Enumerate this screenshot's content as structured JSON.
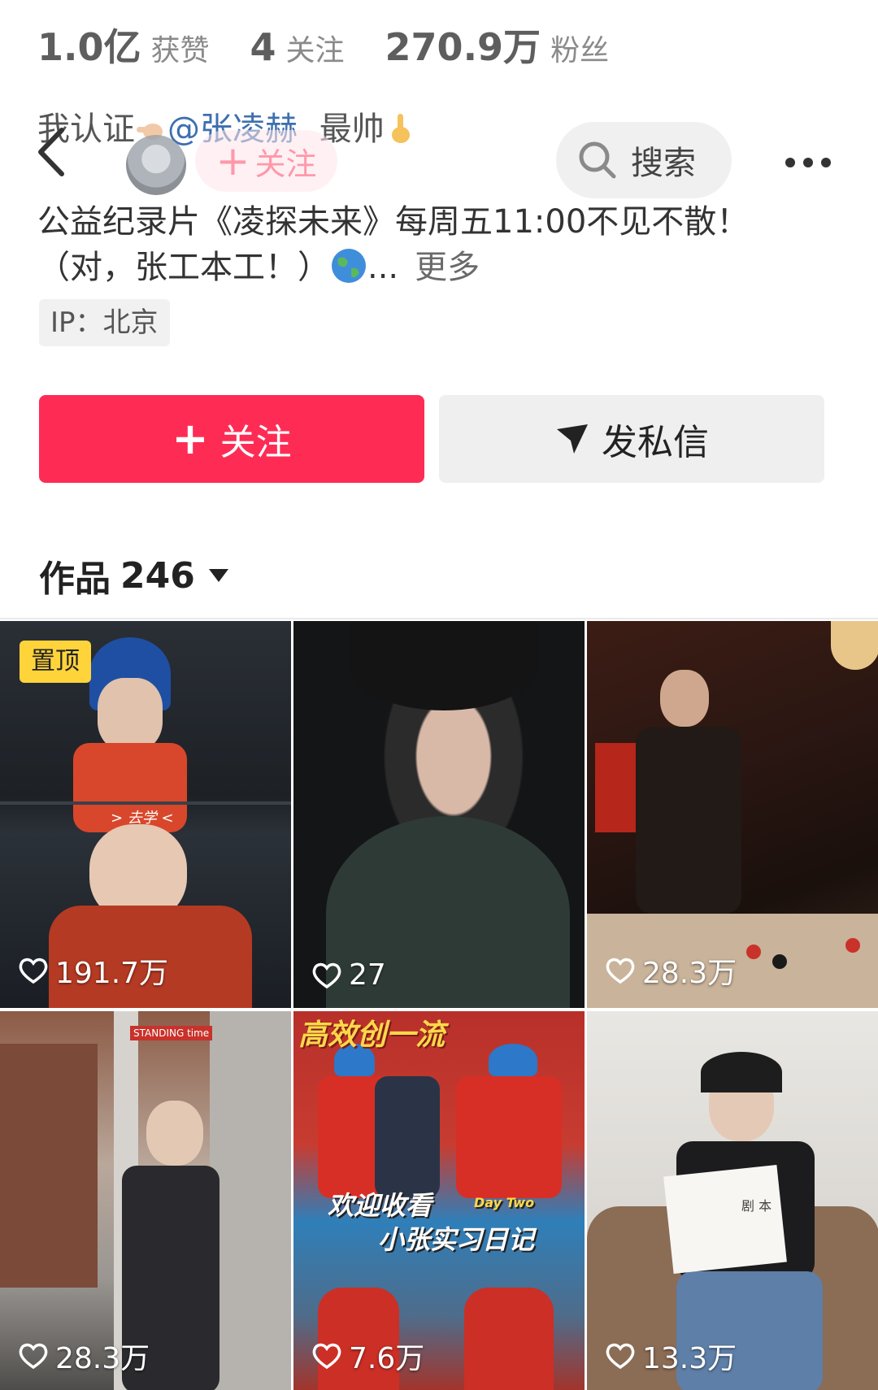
{
  "stats": {
    "likes_value": "1.0亿",
    "likes_label": "获赞",
    "following_value": "4",
    "following_label": "关注",
    "followers_value": "270.9万",
    "followers_label": "粉丝"
  },
  "bio": {
    "line1_prefix": "我认证",
    "mention": "@张凌赫",
    "line1_suffix": "最帅",
    "line2": "公益纪录片《凌探未来》每周五11:00不见不散！",
    "line3": "（对，张工本工！）",
    "ellipsis": "...",
    "more": "更多"
  },
  "ip": "IP：北京",
  "navbar": {
    "follow_label": "关注",
    "search_label": "搜索"
  },
  "actions": {
    "follow_label": "关注",
    "message_label": "发私信"
  },
  "works": {
    "label": "作品",
    "count": "246"
  },
  "tiles": [
    {
      "pinned": "置顶",
      "likes": "191.7万",
      "caption": "> 去学 <"
    },
    {
      "likes": "27"
    },
    {
      "likes": "28.3万"
    },
    {
      "likes": "28.3万",
      "sign": "STANDING time"
    },
    {
      "likes": "7.6万",
      "caption_top": "高效创一流",
      "caption1": "欢迎收看",
      "caption2": "Day Two",
      "caption3": "小张实习日记"
    },
    {
      "likes": "13.3万",
      "script_text": "剧 本"
    }
  ],
  "colors": {
    "accent": "#fe2c55",
    "mention": "#3e6fb0",
    "pin_badge": "#ffd43b"
  }
}
